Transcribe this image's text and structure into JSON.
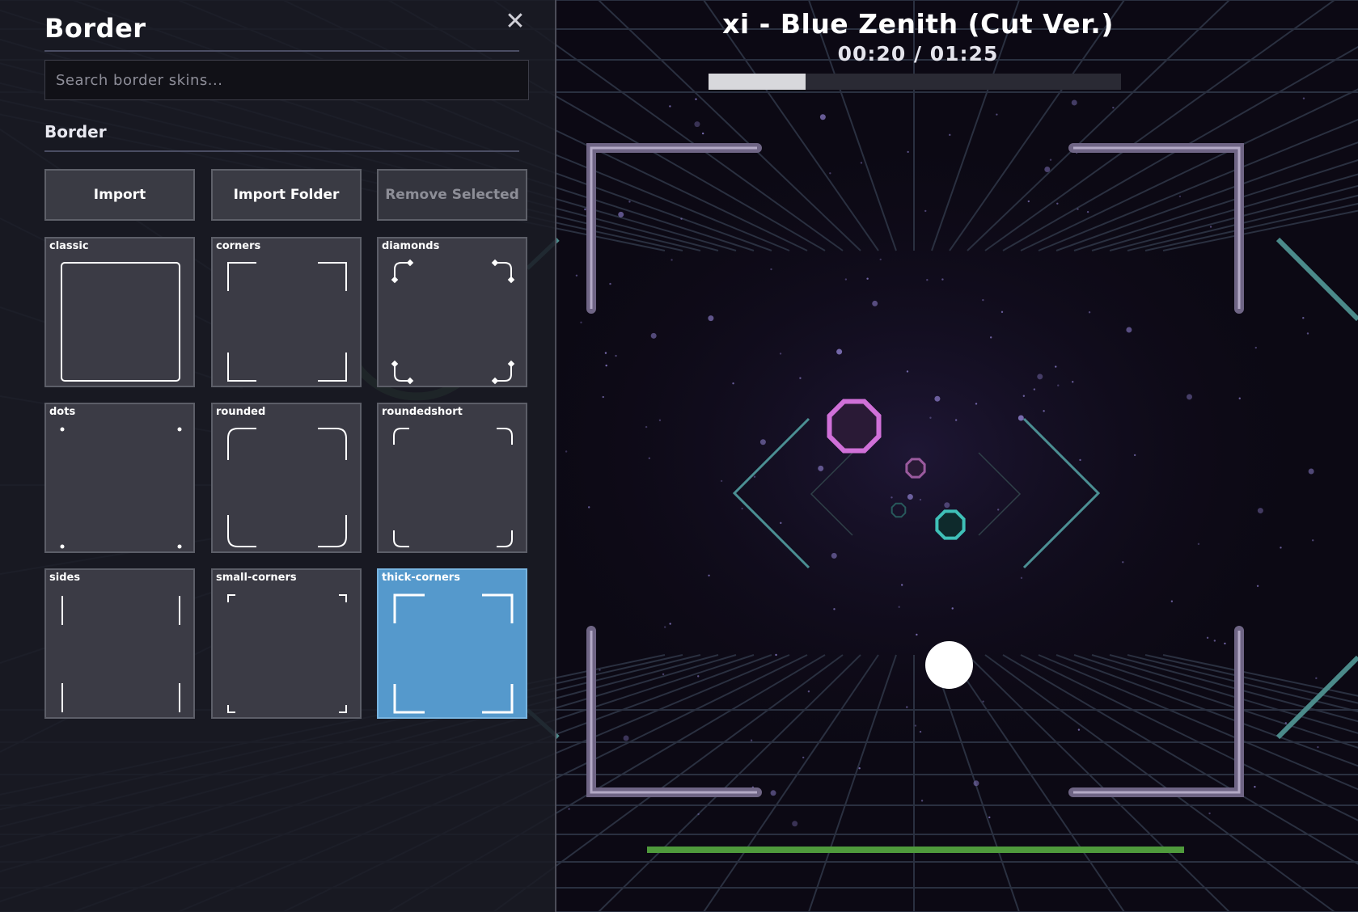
{
  "panel": {
    "title": "Border",
    "close_icon": "close-icon",
    "search_placeholder": "Search border skins...",
    "section_label": "Border",
    "buttons": {
      "import": "Import",
      "import_folder": "Import Folder",
      "remove_selected": "Remove Selected"
    },
    "skins": [
      {
        "name": "classic",
        "selected": false
      },
      {
        "name": "corners",
        "selected": false
      },
      {
        "name": "diamonds",
        "selected": false
      },
      {
        "name": "dots",
        "selected": false
      },
      {
        "name": "rounded",
        "selected": false
      },
      {
        "name": "roundedshort",
        "selected": false
      },
      {
        "name": "sides",
        "selected": false
      },
      {
        "name": "small-corners",
        "selected": false
      },
      {
        "name": "thick-corners",
        "selected": true
      }
    ]
  },
  "hud": {
    "song_title": "xi - Blue Zenith (Cut Ver.)",
    "time_display": "00:20 / 01:25",
    "progress_fraction": 0.235,
    "health_fraction": 1.0
  },
  "colors": {
    "background": "#0c0914",
    "selected_tile": "#5599cc",
    "health": "#4f9a3c",
    "note_pink": "#d070d8",
    "note_teal": "#3fc0b8",
    "border_frame": "#6f6585"
  }
}
